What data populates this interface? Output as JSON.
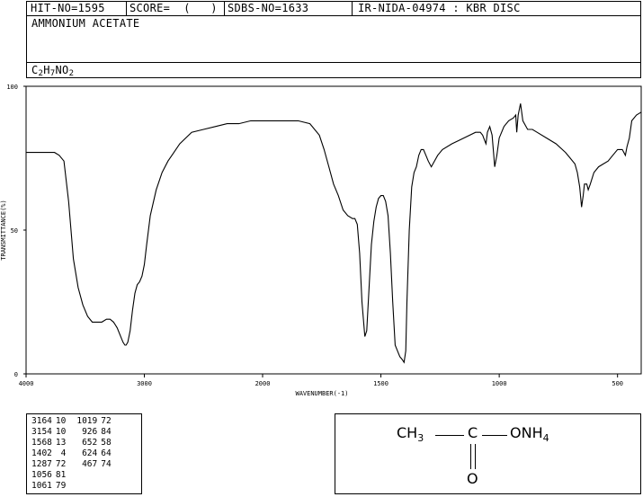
{
  "header": {
    "hit_no": "HIT-NO=1595",
    "score": "SCORE=  (   )",
    "sdbs_no": "SDBS-NO=1633",
    "ir": "IR-NIDA-04974 : KBR DISC"
  },
  "compound": {
    "name": "AMMONIUM ACETATE",
    "formula_parts": [
      "C",
      "2",
      "H",
      "7",
      "NO",
      "2"
    ]
  },
  "chart_data": {
    "type": "line",
    "xlabel": "WAVENUMBER(-1)",
    "ylabel": "TRANSMITTANCE(%)",
    "xlim": [
      4000,
      400
    ],
    "ylim": [
      0,
      100
    ],
    "x_ticks": [
      4000,
      3000,
      2000,
      1500,
      1000,
      500
    ],
    "y_ticks": [
      0,
      50,
      100
    ],
    "series": [
      {
        "x": [
          4000,
          3900,
          3800,
          3760,
          3720,
          3680,
          3640,
          3600,
          3560,
          3520,
          3480,
          3440,
          3400,
          3360,
          3320,
          3290,
          3260,
          3230,
          3200,
          3180,
          3164,
          3154,
          3140,
          3120,
          3100,
          3080,
          3060,
          3040,
          3020,
          3000,
          2980,
          2950,
          2900,
          2850,
          2800,
          2750,
          2700,
          2600,
          2500,
          2400,
          2300,
          2200,
          2100,
          2000,
          1900,
          1850,
          1800,
          1760,
          1740,
          1720,
          1700,
          1680,
          1660,
          1640,
          1620,
          1610,
          1600,
          1590,
          1580,
          1568,
          1560,
          1550,
          1540,
          1530,
          1520,
          1510,
          1500,
          1490,
          1480,
          1470,
          1460,
          1450,
          1440,
          1430,
          1420,
          1410,
          1402,
          1395,
          1390,
          1380,
          1370,
          1360,
          1350,
          1340,
          1330,
          1320,
          1310,
          1300,
          1287,
          1280,
          1260,
          1240,
          1200,
          1150,
          1100,
          1080,
          1070,
          1061,
          1056,
          1050,
          1040,
          1030,
          1019,
          1010,
          1000,
          980,
          960,
          940,
          930,
          926,
          920,
          910,
          900,
          880,
          860,
          840,
          800,
          760,
          720,
          700,
          680,
          670,
          660,
          652,
          645,
          640,
          630,
          624,
          615,
          600,
          580,
          560,
          540,
          520,
          500,
          480,
          467,
          460,
          450,
          440,
          420,
          400
        ],
        "y": [
          77,
          77,
          77,
          77,
          76,
          74,
          60,
          40,
          30,
          24,
          20,
          18,
          18,
          18,
          19,
          19,
          18,
          16,
          13,
          11,
          10,
          10,
          11,
          15,
          22,
          28,
          31,
          32,
          34,
          38,
          45,
          55,
          64,
          70,
          74,
          77,
          80,
          84,
          85,
          86,
          87,
          87,
          88,
          88,
          88,
          88,
          87,
          83,
          78,
          72,
          66,
          62,
          57,
          55,
          54,
          54,
          52,
          42,
          25,
          13,
          15,
          30,
          45,
          53,
          58,
          61,
          62,
          62,
          60,
          55,
          42,
          25,
          10,
          8,
          6,
          5,
          4,
          8,
          25,
          50,
          65,
          70,
          72,
          76,
          78,
          78,
          76,
          74,
          72,
          73,
          76,
          78,
          80,
          82,
          84,
          84,
          83,
          81,
          80,
          84,
          86,
          83,
          72,
          76,
          82,
          86,
          88,
          89,
          90,
          84,
          90,
          94,
          88,
          85,
          85,
          84,
          82,
          80,
          77,
          75,
          73,
          70,
          65,
          58,
          62,
          66,
          66,
          64,
          66,
          70,
          72,
          73,
          74,
          76,
          78,
          78,
          76,
          79,
          82,
          88,
          90,
          91
        ]
      }
    ]
  },
  "peak_table": [
    [
      "3164",
      "10",
      "1019",
      "72"
    ],
    [
      "3154",
      "10",
      "926",
      "84"
    ],
    [
      "1568",
      "13",
      "652",
      "58"
    ],
    [
      "1402",
      "4",
      "624",
      "64"
    ],
    [
      "1287",
      "72",
      "467",
      "74"
    ],
    [
      "1056",
      "81",
      "",
      ""
    ],
    [
      "1061",
      "79",
      "",
      ""
    ]
  ],
  "structure": {
    "left_group": "CH",
    "left_sub": "3",
    "center": "C",
    "right_group": "ONH",
    "right_sub": "4",
    "oxygen": "O"
  }
}
